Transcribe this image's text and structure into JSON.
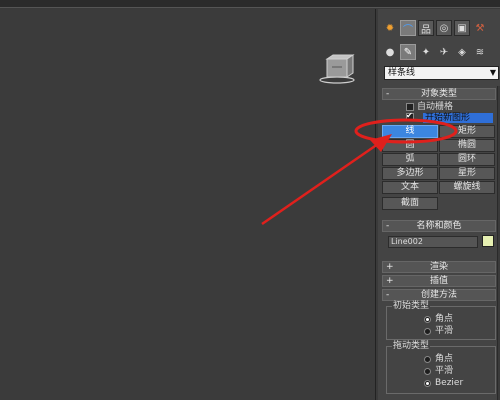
{
  "command_panel": {
    "tabs_row1": [
      {
        "icon": "sun-icon",
        "glyph": "✹",
        "active": false
      },
      {
        "icon": "curve-modify-icon",
        "glyph": "⌒",
        "active": true
      },
      {
        "icon": "hierarchy-icon",
        "glyph": "品",
        "active": false
      },
      {
        "icon": "motion-icon",
        "glyph": "◎",
        "active": false
      },
      {
        "icon": "display-icon",
        "glyph": "▣",
        "active": false
      },
      {
        "icon": "utilities-icon",
        "glyph": "⚒",
        "active": false
      }
    ],
    "tabs_row2": [
      {
        "icon": "geometry-icon",
        "glyph": "●",
        "active": false
      },
      {
        "icon": "shapes-icon",
        "glyph": "✎",
        "active": true
      },
      {
        "icon": "lights-icon",
        "glyph": "✦",
        "active": false
      },
      {
        "icon": "cameras-icon",
        "glyph": "✈",
        "active": false
      },
      {
        "icon": "helpers-icon",
        "glyph": "◈",
        "active": false
      },
      {
        "icon": "spacewarps-icon",
        "glyph": "≋",
        "active": false
      },
      {
        "icon": "systems-icon",
        "glyph": "✣",
        "active": false
      }
    ],
    "category_dropdown": "样条线",
    "object_type": {
      "title": "对象类型",
      "autogrid_label": "自动栅格",
      "start_new_label": "开始新图形",
      "buttons": [
        {
          "label": "线",
          "selected": true
        },
        {
          "label": "矩形",
          "selected": false
        },
        {
          "label": "圆",
          "selected": false
        },
        {
          "label": "椭圆",
          "selected": false
        },
        {
          "label": "弧",
          "selected": false
        },
        {
          "label": "圆环",
          "selected": false
        },
        {
          "label": "多边形",
          "selected": false
        },
        {
          "label": "星形",
          "selected": false
        },
        {
          "label": "文本",
          "selected": false
        },
        {
          "label": "螺旋线",
          "selected": false
        },
        {
          "label": "截面",
          "selected": false
        }
      ]
    },
    "name_color": {
      "title": "名称和颜色",
      "name_value": "Line002",
      "color": "#e6f0b2"
    },
    "rendering": {
      "title": "渲染"
    },
    "interpolation": {
      "title": "插值"
    },
    "creation_method": {
      "title": "创建方法",
      "initial_type": {
        "title": "初始类型",
        "options": [
          "角点",
          "平滑"
        ],
        "selected": 0
      },
      "drag_type": {
        "title": "拖动类型",
        "options": [
          "角点",
          "平滑",
          "Bezier"
        ],
        "selected": 2
      }
    },
    "rollout_expanded_sign": "-",
    "rollout_collapsed_sign": "+"
  },
  "colors": {
    "viewport_bg": "#3b3b3b",
    "panel_bg": "#444444",
    "selected_button": "#3c86e0",
    "annotation_red": "#e0201c"
  }
}
